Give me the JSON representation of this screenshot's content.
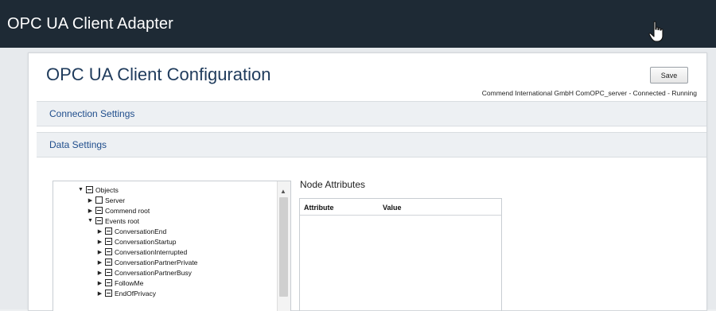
{
  "app": {
    "title": "OPC UA Client Adapter"
  },
  "page": {
    "title": "OPC UA Client Configuration",
    "save_label": "Save",
    "status": "Commend International GmbH ComOPC_server - Connected - Running"
  },
  "sections": {
    "connection": "Connection Settings",
    "data": "Data Settings"
  },
  "tree": {
    "items": [
      {
        "label": "Objects",
        "level": 0,
        "expanded": true,
        "node": "minus"
      },
      {
        "label": "Server",
        "level": 1,
        "expanded": false,
        "node": "empty"
      },
      {
        "label": "Commend root",
        "level": 1,
        "expanded": false,
        "node": "minus"
      },
      {
        "label": "Events root",
        "level": 1,
        "expanded": true,
        "node": "minus"
      },
      {
        "label": "ConversationEnd",
        "level": 2,
        "expanded": false,
        "node": "minus"
      },
      {
        "label": "ConversationStartup",
        "level": 2,
        "expanded": false,
        "node": "minus"
      },
      {
        "label": "ConversationInterrupted",
        "level": 2,
        "expanded": false,
        "node": "minus"
      },
      {
        "label": "ConversationPartnerPrivate",
        "level": 2,
        "expanded": false,
        "node": "minus"
      },
      {
        "label": "ConversationPartnerBusy",
        "level": 2,
        "expanded": false,
        "node": "minus"
      },
      {
        "label": "FollowMe",
        "level": 2,
        "expanded": false,
        "node": "minus"
      },
      {
        "label": "EndOfPrivacy",
        "level": 2,
        "expanded": false,
        "node": "minus"
      }
    ]
  },
  "attributes": {
    "title": "Node Attributes",
    "columns": [
      "Attribute",
      "Value"
    ]
  },
  "icons": {
    "cursor": "hand-pointer-icon",
    "expanded": "triangle-down-icon",
    "collapsed": "triangle-right-icon",
    "scroll_up": "scroll-up-arrow-icon"
  },
  "colors": {
    "header_bg": "#1e2a35",
    "title_color": "#1f3b5c",
    "section_link": "#1f4d8c"
  }
}
